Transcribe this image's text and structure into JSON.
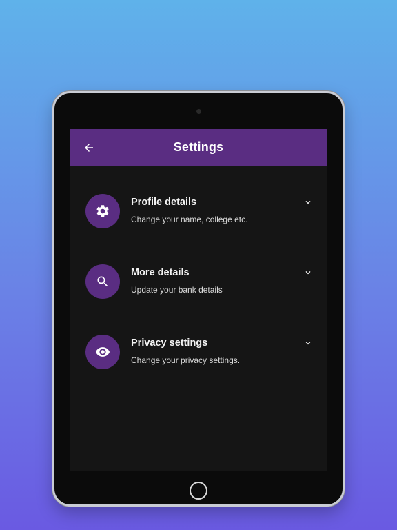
{
  "appbar": {
    "title": "Settings",
    "back_icon": "arrow-left-icon"
  },
  "settings": {
    "items": [
      {
        "title": "Profile details",
        "subtitle": "Change your name, college etc.",
        "icon": "gear-icon"
      },
      {
        "title": "More details",
        "subtitle": "Update your bank details",
        "icon": "search-icon"
      },
      {
        "title": "Privacy settings",
        "subtitle": "Change your privacy settings.",
        "icon": "eye-icon"
      }
    ]
  },
  "colors": {
    "accent": "#5a2d82",
    "screen_bg": "#151515",
    "background_top": "#5fb2ea",
    "background_bottom": "#6a5ae2"
  }
}
